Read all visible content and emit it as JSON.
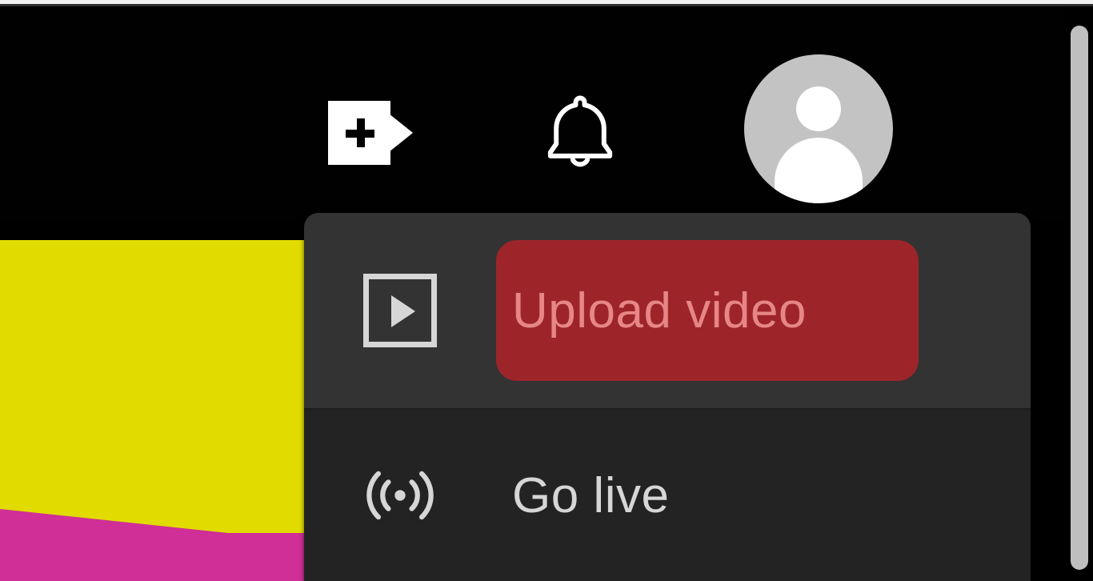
{
  "header": {
    "create_button_name": "create-button",
    "notifications_button_name": "notifications-button",
    "avatar_button_name": "account-avatar"
  },
  "create_menu": {
    "items": [
      {
        "icon": "play-square-icon",
        "label": "Upload video",
        "highlighted": true
      },
      {
        "icon": "broadcast-icon",
        "label": "Go live",
        "highlighted": false
      }
    ]
  }
}
